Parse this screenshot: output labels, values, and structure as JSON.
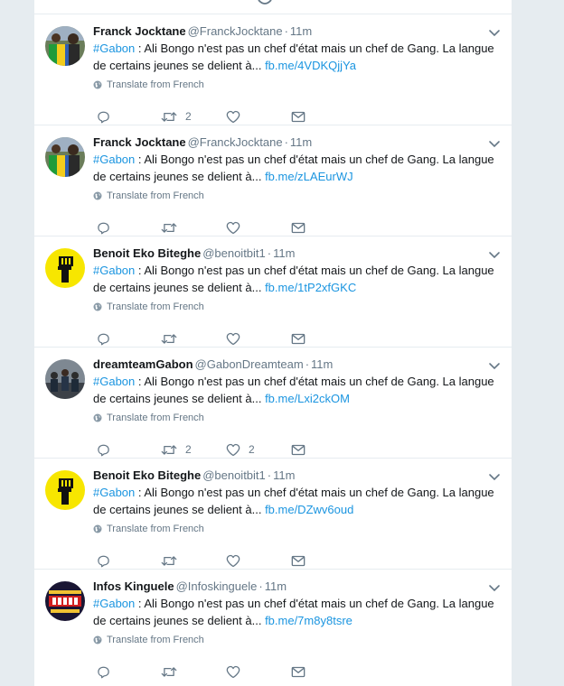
{
  "colors": {
    "link": "#1b95e0",
    "secondary_text": "#657786",
    "background": "#e6ecf0"
  },
  "tweets": [
    {
      "avatar": "franck-avatar",
      "name": "Franck Jocktane",
      "handle": "@FranckJocktane",
      "time": "11m",
      "hashtag": "#Gabon",
      "body": " : Ali Bongo n'est pas un chef d'état mais un chef de Gang. La langue de certains jeunes se delient à... ",
      "link": "fb.me/4VDKQjjYa",
      "translate": "Translate from French",
      "retweets": "2",
      "likes": ""
    },
    {
      "avatar": "franck-avatar",
      "name": "Franck Jocktane",
      "handle": "@FranckJocktane",
      "time": "11m",
      "hashtag": "#Gabon",
      "body": " : Ali Bongo n'est pas un chef d'état mais un chef de Gang. La langue de certains jeunes se delient à... ",
      "link": "fb.me/zLAEurWJ",
      "translate": "Translate from French",
      "retweets": "",
      "likes": ""
    },
    {
      "avatar": "fist-avatar",
      "name": "Benoit Eko Biteghe",
      "handle": "@benoitbit1",
      "time": "11m",
      "hashtag": "#Gabon",
      "body": " : Ali Bongo n'est pas un chef d'état mais un chef de Gang. La langue de certains jeunes se delient à... ",
      "link": "fb.me/1tP2xfGKC",
      "translate": "Translate from French",
      "retweets": "",
      "likes": ""
    },
    {
      "avatar": "group-avatar",
      "name": "dreamteamGabon",
      "handle": "@GabonDreamteam",
      "time": "11m",
      "hashtag": "#Gabon",
      "body": " : Ali Bongo n'est pas un chef d'état mais un chef de Gang. La langue de certains jeunes se delient à... ",
      "link": "fb.me/Lxi2ckOM",
      "translate": "Translate from French",
      "retweets": "2",
      "likes": "2"
    },
    {
      "avatar": "fist-avatar",
      "name": "Benoit Eko Biteghe",
      "handle": "@benoitbit1",
      "time": "11m",
      "hashtag": "#Gabon",
      "body": " : Ali Bongo n'est pas un chef d'état mais un chef de Gang. La langue de certains jeunes se delient à... ",
      "link": "fb.me/DZwv6oud",
      "translate": "Translate from French",
      "retweets": "",
      "likes": ""
    },
    {
      "avatar": "infos-avatar",
      "name": "Infos Kinguele",
      "handle": "@Infoskinguele",
      "time": "11m",
      "hashtag": "#Gabon",
      "body": " : Ali Bongo n'est pas un chef d'état mais un chef de Gang. La langue de certains jeunes se delient à... ",
      "link": "fb.me/7m8y8tsre",
      "translate": "Translate from French",
      "retweets": "",
      "likes": ""
    }
  ]
}
